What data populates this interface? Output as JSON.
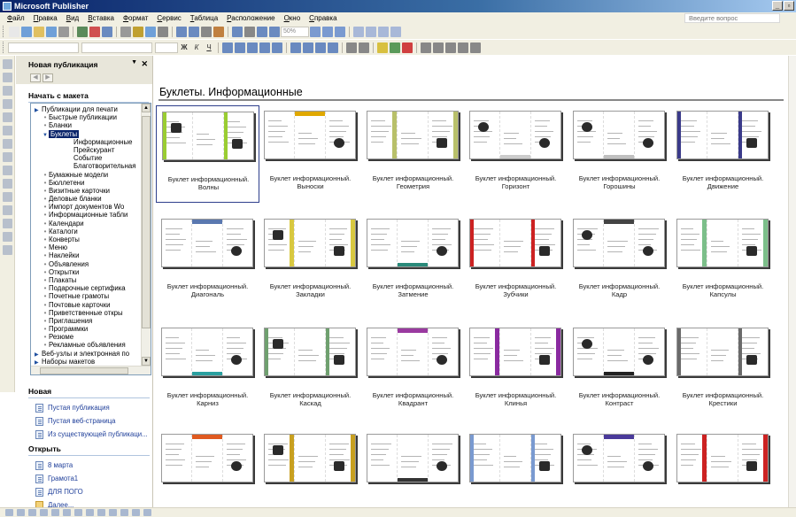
{
  "window": {
    "title": "Microsoft Publisher",
    "buttons": [
      "_",
      "▫",
      "×"
    ]
  },
  "menu": {
    "items": [
      "Файл",
      "Правка",
      "Вид",
      "Вставка",
      "Формат",
      "Сервис",
      "Таблица",
      "Расположение",
      "Окно",
      "Справка"
    ],
    "ask_placeholder": "Введите вопрос"
  },
  "toolbar": {
    "zoom": "50%",
    "font_style_letters": [
      "Ж",
      "К",
      "Ч"
    ]
  },
  "task_pane": {
    "title": "Новая публикация",
    "section_start": "Начать с макета",
    "tree": [
      {
        "label": "Публикации для печати",
        "level": 0,
        "kind": "tri"
      },
      {
        "label": "Быстрые публикации",
        "level": 1,
        "kind": "dot"
      },
      {
        "label": "Бланки",
        "level": 1,
        "kind": "dot"
      },
      {
        "label": "Буклеты",
        "level": 1,
        "kind": "tri",
        "selected": true
      },
      {
        "label": "Информационные",
        "level": 2
      },
      {
        "label": "Прейскурант",
        "level": 2
      },
      {
        "label": "Событие",
        "level": 2
      },
      {
        "label": "Благотворительная",
        "level": 2
      },
      {
        "label": "Бумажные модели",
        "level": 1,
        "kind": "dot"
      },
      {
        "label": "Бюллетени",
        "level": 1,
        "kind": "dot"
      },
      {
        "label": "Визитные карточки",
        "level": 1,
        "kind": "dot"
      },
      {
        "label": "Деловые бланки",
        "level": 1,
        "kind": "dot"
      },
      {
        "label": "Импорт документов Wo",
        "level": 1,
        "kind": "dot"
      },
      {
        "label": "Информационные табли",
        "level": 1,
        "kind": "dot"
      },
      {
        "label": "Календари",
        "level": 1,
        "kind": "dot"
      },
      {
        "label": "Каталоги",
        "level": 1,
        "kind": "dot"
      },
      {
        "label": "Конверты",
        "level": 1,
        "kind": "dot"
      },
      {
        "label": "Меню",
        "level": 1,
        "kind": "dot"
      },
      {
        "label": "Наклейки",
        "level": 1,
        "kind": "dot"
      },
      {
        "label": "Объявления",
        "level": 1,
        "kind": "dot"
      },
      {
        "label": "Открытки",
        "level": 1,
        "kind": "dot"
      },
      {
        "label": "Плакаты",
        "level": 1,
        "kind": "dot"
      },
      {
        "label": "Подарочные сертифика",
        "level": 1,
        "kind": "dot"
      },
      {
        "label": "Почетные грамоты",
        "level": 1,
        "kind": "dot"
      },
      {
        "label": "Почтовые карточки",
        "level": 1,
        "kind": "dot"
      },
      {
        "label": "Приветственные откры",
        "level": 1,
        "kind": "dot"
      },
      {
        "label": "Приглашения",
        "level": 1,
        "kind": "dot"
      },
      {
        "label": "Программки",
        "level": 1,
        "kind": "dot"
      },
      {
        "label": "Резюме",
        "level": 1,
        "kind": "dot"
      },
      {
        "label": "Рекламные объявления",
        "level": 1,
        "kind": "dot"
      },
      {
        "label": "Веб-узлы и электронная по",
        "level": 0,
        "kind": "tri"
      },
      {
        "label": "Наборы макетов",
        "level": 0,
        "kind": "tri"
      }
    ],
    "section_new": "Новая",
    "new_links": [
      "Пустая публикация",
      "Пустая веб-страница",
      "Из существующей публикаци..."
    ],
    "section_open": "Открыть",
    "open_links": [
      "8 марта",
      "Грамота1",
      "ДЛЯ ПОГО",
      "Далее..."
    ]
  },
  "gallery": {
    "title": "Буклеты. Информационные",
    "items": [
      {
        "line1": "Буклет информационный.",
        "line2": "Волны",
        "accent": "#9acd32",
        "style": 0,
        "selected": true
      },
      {
        "line1": "Буклет информационный.",
        "line2": "Выноски",
        "accent": "#e0a800",
        "style": 1
      },
      {
        "line1": "Буклет информационный.",
        "line2": "Геометрия",
        "accent": "#b8c06a",
        "style": 2
      },
      {
        "line1": "Буклет информационный.",
        "line2": "Горизонт",
        "accent": "#cccccc",
        "style": 3
      },
      {
        "line1": "Буклет информационный.",
        "line2": "Горошины",
        "accent": "#c0c0c0",
        "style": 3
      },
      {
        "line1": "Буклет информационный.",
        "line2": "Движение",
        "accent": "#3a3a8a",
        "style": 4
      },
      {
        "line1": "Буклет информационный.",
        "line2": "Диагональ",
        "accent": "#5a78b0",
        "style": 5
      },
      {
        "line1": "Буклет информационный.",
        "line2": "Закладки",
        "accent": "#d8c840",
        "style": 6
      },
      {
        "line1": "Буклет информационный.",
        "line2": "Затмение",
        "accent": "#2a8a7a",
        "style": 7
      },
      {
        "line1": "Буклет информационный.",
        "line2": "Зубчики",
        "accent": "#cc2222",
        "style": 8
      },
      {
        "line1": "Буклет информационный.",
        "line2": "Кадр",
        "accent": "#444444",
        "style": 9
      },
      {
        "line1": "Буклет информационный.",
        "line2": "Капсулы",
        "accent": "#7cbf8a",
        "style": 10
      },
      {
        "line1": "Буклет информационный.",
        "line2": "Карниз",
        "accent": "#2aa0a0",
        "style": 11
      },
      {
        "line1": "Буклет информационный.",
        "line2": "Каскад",
        "accent": "#6fa06f",
        "style": 12
      },
      {
        "line1": "Буклет информационный.",
        "line2": "Квадрант",
        "accent": "#9a3aa0",
        "style": 13
      },
      {
        "line1": "Буклет информационный.",
        "line2": "Клинья",
        "accent": "#8a2aa0",
        "style": 14
      },
      {
        "line1": "Буклет информационный.",
        "line2": "Контраст",
        "accent": "#222222",
        "style": 15
      },
      {
        "line1": "Буклет информационный.",
        "line2": "Крестики",
        "accent": "#6a6a6a",
        "style": 16
      },
      {
        "line1": "",
        "line2": "",
        "accent": "#e05a20",
        "style": 17
      },
      {
        "line1": "",
        "line2": "",
        "accent": "#c8a020",
        "style": 18
      },
      {
        "line1": "",
        "line2": "",
        "accent": "#333333",
        "style": 19
      },
      {
        "line1": "",
        "line2": "",
        "accent": "#7a9ad0",
        "style": 20
      },
      {
        "line1": "",
        "line2": "",
        "accent": "#4a3a9a",
        "style": 21
      },
      {
        "line1": "",
        "line2": "",
        "accent": "#cc2222",
        "style": 22
      }
    ]
  }
}
